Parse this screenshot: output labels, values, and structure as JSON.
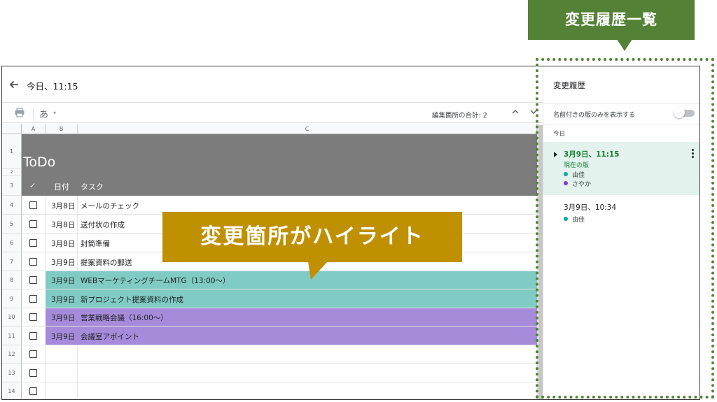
{
  "header": {
    "title": "今日、11:15"
  },
  "toolbar": {
    "font_label": "あ",
    "edit_count": "編集箇所の合計: 2"
  },
  "sheet": {
    "columns": [
      "A",
      "B",
      "C"
    ],
    "title": "ToDo",
    "header_row": {
      "check": "✓",
      "date": "日付",
      "task": "タスク"
    },
    "rows": [
      {
        "num": "1"
      },
      {
        "num": "2"
      },
      {
        "num": "3"
      },
      {
        "num": "4",
        "date": "3月8日",
        "task": "メールのチェック"
      },
      {
        "num": "5",
        "date": "3月8日",
        "task": "送付状の作成"
      },
      {
        "num": "6",
        "date": "3月8日",
        "task": "封筒準備"
      },
      {
        "num": "7",
        "date": "3月9日",
        "task": "提案資料の郵送"
      },
      {
        "num": "8",
        "date": "3月9日",
        "task": "WEBマーケティングチームMTG（13:00～）"
      },
      {
        "num": "9",
        "date": "3月9日",
        "task": "新プロジェクト提案資料の作成"
      },
      {
        "num": "10",
        "date": "3月9日",
        "task": "営業戦略会議（16:00～）"
      },
      {
        "num": "11",
        "date": "3月9日",
        "task": "会議室アポイント"
      },
      {
        "num": "12"
      },
      {
        "num": "13"
      },
      {
        "num": "14"
      }
    ]
  },
  "panel": {
    "title": "変更履歴",
    "named_only_label": "名前付きの版のみを表示する",
    "named_only_enabled": false,
    "today_label": "今日",
    "versions": [
      {
        "time": "3月9日、11:15",
        "state": "現在の版",
        "authors": [
          "由佳",
          "さやか"
        ]
      },
      {
        "time": "3月9日、10:34",
        "authors": [
          "由佳"
        ]
      }
    ]
  },
  "colors": {
    "author1": "#12a4a1",
    "author2": "#7b3fc4",
    "highlight1": "#80cbc4",
    "highlight2": "#a78bdb",
    "callout_green": "#538135",
    "callout_gold": "#bf9000"
  },
  "annotations": {
    "history_list": "変更履歴一覧",
    "highlight_note": "変更箇所がハイライト"
  }
}
